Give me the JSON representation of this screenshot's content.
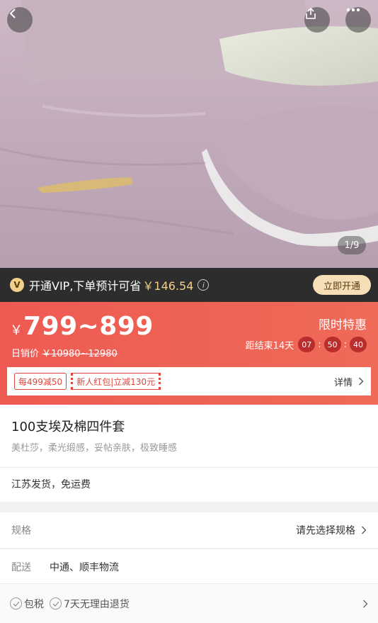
{
  "gallery": {
    "counter": "1/9",
    "pillow_text": "LAWRENCE"
  },
  "vip": {
    "badge": "V",
    "text": "开通VIP,下单预计可省",
    "amount": "￥146.54",
    "info_icon": "info-icon",
    "button": "立即开通"
  },
  "promo": {
    "currency": "￥",
    "price": "799~899",
    "daily_label": "日销价",
    "daily_price": "￥10980~12980",
    "limited": "限时特惠",
    "countdown_label": "距结束14天",
    "countdown": [
      "07",
      "50",
      "40"
    ],
    "coupons": [
      "每499减50",
      "新人红包|立减130元"
    ],
    "detail_label": "详情"
  },
  "product": {
    "title": "100支埃及棉四件套",
    "subtitle": "美杜莎，柔光缎感，妥帖亲肤，极致睡感",
    "shipping": "江苏发货，免运费"
  },
  "spec": {
    "label": "规格",
    "value": "请先选择规格"
  },
  "delivery": {
    "label": "配送",
    "value": "中通、顺丰物流"
  },
  "guarantees": [
    "包税",
    "7天无理由退货"
  ],
  "colors": {
    "accent": "#ee5a52",
    "vip_gold": "#f3cf8a",
    "vip_bar": "#2d2d2d"
  }
}
